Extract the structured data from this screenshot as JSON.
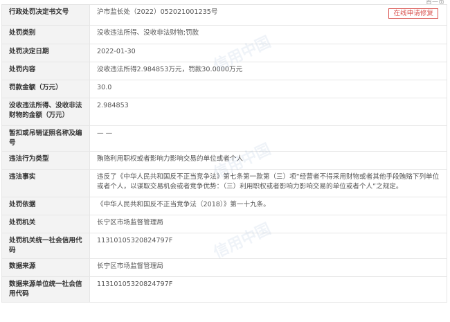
{
  "corner_text": "首一页",
  "repair_button": "在线申请修复",
  "watermark": "信用中国",
  "rows": [
    {
      "label": "行政处罚决定书文号",
      "value": "沪市监长处（2022）052021001235号"
    },
    {
      "label": "处罚类别",
      "value": "没收违法所得、没收非法财物;罚款"
    },
    {
      "label": "处罚决定日期",
      "value": "2022-01-30"
    },
    {
      "label": "处罚内容",
      "value": "没收违法所得2.984853万元，罚款30.0000万元"
    },
    {
      "label": "罚款金额（万元）",
      "value": "30.0"
    },
    {
      "label": "没收违法所得、没收非法财物的金额（万元）",
      "value": "2.984853"
    },
    {
      "label": "暂扣或吊销证照名称及编号",
      "value": "— —"
    },
    {
      "label": "违法行为类型",
      "value": "贿赂利用职权或者影响力影响交易的单位或者个人"
    },
    {
      "label": "违法事实",
      "value": "违反了《中华人民共和国反不正当竞争法》第七条第一款第（三）项“经营者不得采用财物或者其他手段贿赂下列单位或者个人，以谋取交易机会或者竞争优势：（三）利用职权或者影响力影响交易的单位或者个人”之规定。"
    },
    {
      "label": "处罚依据",
      "value": "《中华人民共和国反不正当竞争法（2018）》第一十九条。"
    },
    {
      "label": "处罚机关",
      "value": "长宁区市场监督管理局"
    },
    {
      "label": "处罚机关统一社会信用代码",
      "value": "11310105320824797F"
    },
    {
      "label": "数据来源",
      "value": "长宁区市场监督管理局"
    },
    {
      "label": "数据来源单位统一社会信用代码",
      "value": "11310105320824797F"
    }
  ]
}
